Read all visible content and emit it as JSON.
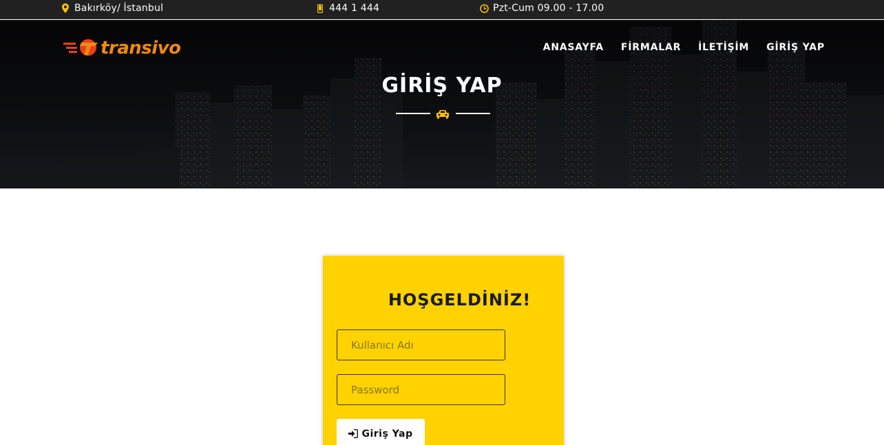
{
  "topbar": {
    "location": "Bakırköy/ İstanbul",
    "phone": "444 1 444",
    "hours": "Pzt-Cum 09.00 - 17.00",
    "icons": {
      "location": "map-marker-icon",
      "phone": "mobile-phone-icon",
      "hours": "clock-icon"
    },
    "accent": "#ffc107"
  },
  "header": {
    "logo_text": "transivo",
    "nav": [
      {
        "label": "ANASAYFA"
      },
      {
        "label": "FİRMALAR"
      },
      {
        "label": "İLETİŞİM"
      },
      {
        "label": "GİRİŞ YAP"
      }
    ],
    "page_title": "GİRİŞ YAP",
    "divider_icon": "car-icon"
  },
  "login": {
    "title": "HOŞGELDİNİZ!",
    "username_placeholder": "Kullanıcı Adı",
    "password_placeholder": "Password",
    "submit_label": "Giriş Yap",
    "submit_icon": "sign-in-icon",
    "card_color": "#ffd200"
  }
}
